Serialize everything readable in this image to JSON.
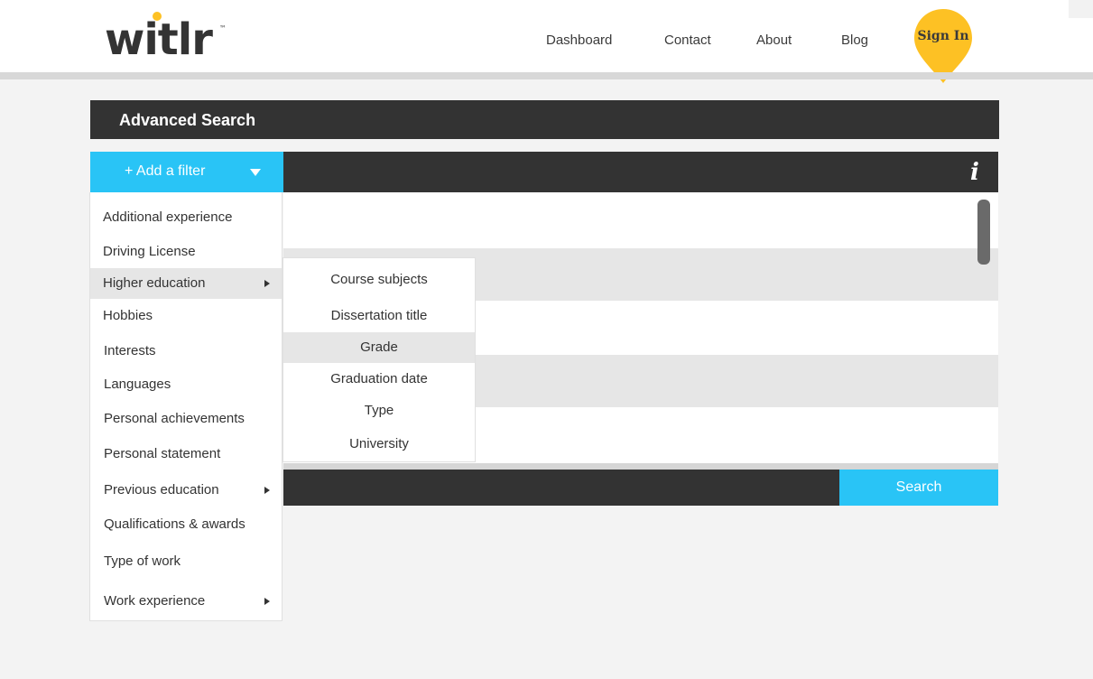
{
  "header": {
    "logo_text": "witlr",
    "logo_tm": "™",
    "nav": [
      "Dashboard",
      "Contact",
      "About",
      "Blog"
    ],
    "signin_label": "Sign In",
    "brand_yellow": "#fdc124"
  },
  "search": {
    "title": "Advanced Search",
    "add_filter_label": "+ Add a filter",
    "info_icon": "i",
    "search_button": "Search",
    "accent_color": "#29c4f6"
  },
  "filter_menu": {
    "items": [
      {
        "label": "Additional experience",
        "has_submenu": false
      },
      {
        "label": "Driving License",
        "has_submenu": false
      },
      {
        "label": "Higher education",
        "has_submenu": true,
        "active": true
      },
      {
        "label": "Hobbies",
        "has_submenu": false
      },
      {
        "label": "Interests",
        "has_submenu": false
      },
      {
        "label": "Languages",
        "has_submenu": false
      },
      {
        "label": "Personal achievements",
        "has_submenu": false
      },
      {
        "label": "Personal statement",
        "has_submenu": false
      },
      {
        "label": "Previous education",
        "has_submenu": true
      },
      {
        "label": "Qualifications & awards",
        "has_submenu": false
      },
      {
        "label": "Type of work",
        "has_submenu": false
      },
      {
        "label": "Work experience",
        "has_submenu": true
      }
    ]
  },
  "submenu": {
    "items": [
      {
        "label": "Course subjects"
      },
      {
        "label": "Dissertation title"
      },
      {
        "label": "Grade",
        "active": true
      },
      {
        "label": "Graduation date"
      },
      {
        "label": "Type"
      },
      {
        "label": "University"
      }
    ]
  }
}
